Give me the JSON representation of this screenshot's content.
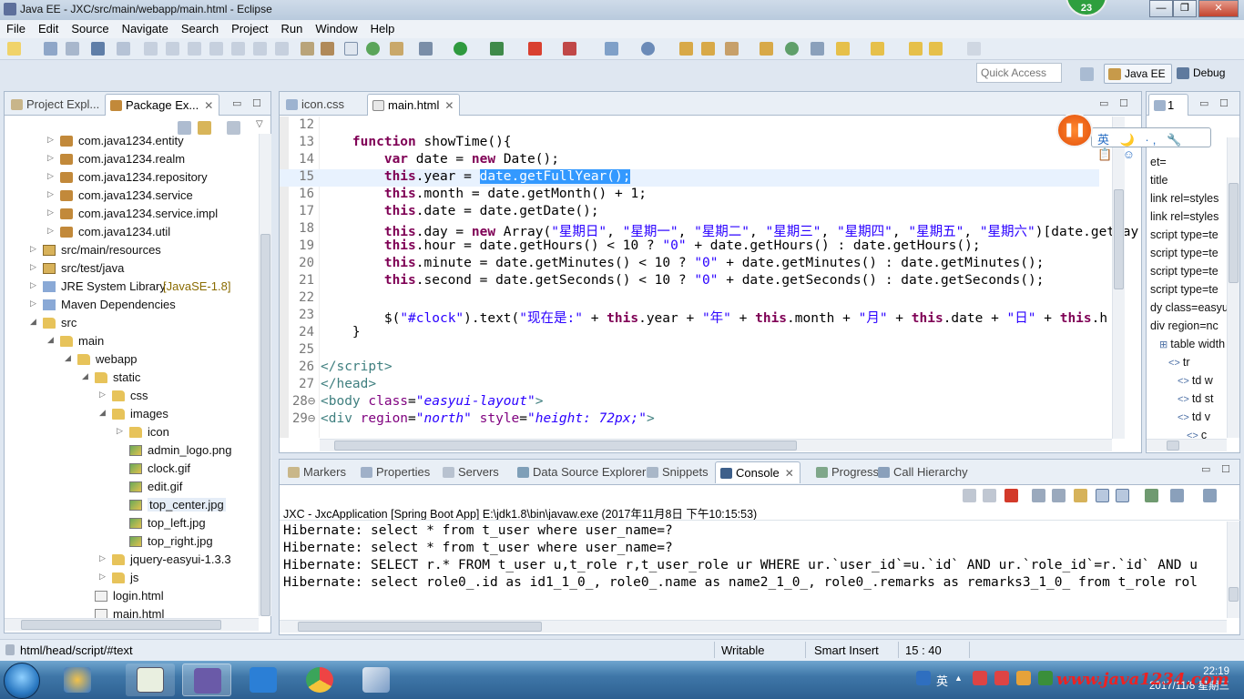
{
  "window": {
    "title": "Java EE - JXC/src/main/webapp/main.html - Eclipse",
    "badge": "23"
  },
  "menu": [
    "File",
    "Edit",
    "Source",
    "Navigate",
    "Search",
    "Project",
    "Run",
    "Window",
    "Help"
  ],
  "perspectives": {
    "quick_access_placeholder": "Quick Access",
    "items": [
      "Java EE",
      "Debug"
    ]
  },
  "explorer": {
    "tabs": [
      "Project Expl...",
      "Package Ex..."
    ],
    "items": [
      {
        "label": "com.java1234.entity",
        "icon": "pkg",
        "indent": 3,
        "twisty": "▷"
      },
      {
        "label": "com.java1234.realm",
        "icon": "pkg",
        "indent": 3,
        "twisty": "▷"
      },
      {
        "label": "com.java1234.repository",
        "icon": "pkg",
        "indent": 3,
        "twisty": "▷"
      },
      {
        "label": "com.java1234.service",
        "icon": "pkg",
        "indent": 3,
        "twisty": "▷"
      },
      {
        "label": "com.java1234.service.impl",
        "icon": "pkg",
        "indent": 3,
        "twisty": "▷"
      },
      {
        "label": "com.java1234.util",
        "icon": "pkg",
        "indent": 3,
        "twisty": "▷"
      },
      {
        "label": "src/main/resources",
        "icon": "srcf",
        "indent": 2,
        "twisty": "▷"
      },
      {
        "label": "src/test/java",
        "icon": "srcf",
        "indent": 2,
        "twisty": "▷"
      },
      {
        "label": "JRE System Library",
        "suffix": "[JavaSE-1.8]",
        "icon": "lib",
        "indent": 2,
        "twisty": "▷"
      },
      {
        "label": "Maven Dependencies",
        "icon": "lib",
        "indent": 2,
        "twisty": "▷"
      },
      {
        "label": "src",
        "icon": "folder",
        "indent": 2,
        "twisty": "◢"
      },
      {
        "label": "main",
        "icon": "folder",
        "indent": 3,
        "twisty": "◢"
      },
      {
        "label": "webapp",
        "icon": "folder",
        "indent": 4,
        "twisty": "◢"
      },
      {
        "label": "static",
        "icon": "folder",
        "indent": 5,
        "twisty": "◢"
      },
      {
        "label": "css",
        "icon": "folder",
        "indent": 6,
        "twisty": "▷"
      },
      {
        "label": "images",
        "icon": "folder",
        "indent": 6,
        "twisty": "◢"
      },
      {
        "label": "icon",
        "icon": "folder",
        "indent": 7,
        "twisty": "▷"
      },
      {
        "label": "admin_logo.png",
        "icon": "img",
        "indent": 7,
        "twisty": ""
      },
      {
        "label": "clock.gif",
        "icon": "img",
        "indent": 7,
        "twisty": ""
      },
      {
        "label": "edit.gif",
        "icon": "img",
        "indent": 7,
        "twisty": ""
      },
      {
        "label": "top_center.jpg",
        "icon": "img",
        "indent": 7,
        "twisty": "",
        "selected": true
      },
      {
        "label": "top_left.jpg",
        "icon": "img",
        "indent": 7,
        "twisty": ""
      },
      {
        "label": "top_right.jpg",
        "icon": "img",
        "indent": 7,
        "twisty": ""
      },
      {
        "label": "jquery-easyui-1.3.3",
        "icon": "folder",
        "indent": 6,
        "twisty": "▷"
      },
      {
        "label": "js",
        "icon": "folder",
        "indent": 6,
        "twisty": "▷"
      },
      {
        "label": "login.html",
        "icon": "html",
        "indent": 5,
        "twisty": ""
      },
      {
        "label": "main.html",
        "icon": "html",
        "indent": 5,
        "twisty": ""
      }
    ]
  },
  "editor": {
    "tabs": [
      "icon.css",
      "main.html"
    ],
    "lines": [
      {
        "n": "12",
        "html": ""
      },
      {
        "n": "13",
        "html": "    <span class='kw'>function</span> showTime(){"
      },
      {
        "n": "14",
        "html": "        <span class='kw'>var</span> date = <span class='kw'>new</span> Date();"
      },
      {
        "n": "15",
        "html": "        <span class='kw'>this</span>.year = <span class='sel-hl'>date.getFullYear();</span>",
        "current": true
      },
      {
        "n": "16",
        "html": "        <span class='kw'>this</span>.month = date.getMonth() + 1;"
      },
      {
        "n": "17",
        "html": "        <span class='kw'>this</span>.date = date.getDate();"
      },
      {
        "n": "18",
        "html": "        <span class='kw'>this</span>.day = <span class='kw'>new</span> Array(<span class='str'>\"星期日\"</span>, <span class='str'>\"星期一\"</span>, <span class='str'>\"星期二\"</span>, <span class='str'>\"星期三\"</span>, <span class='str'>\"星期四\"</span>, <span class='str'>\"星期五\"</span>, <span class='str'>\"星期六\"</span>)[date.getDay("
      },
      {
        "n": "19",
        "html": "        <span class='kw'>this</span>.hour = date.getHours() &lt; 10 ? <span class='str'>\"0\"</span> + date.getHours() : date.getHours();"
      },
      {
        "n": "20",
        "html": "        <span class='kw'>this</span>.minute = date.getMinutes() &lt; 10 ? <span class='str'>\"0\"</span> + date.getMinutes() : date.getMinutes();"
      },
      {
        "n": "21",
        "html": "        <span class='kw'>this</span>.second = date.getSeconds() &lt; 10 ? <span class='str'>\"0\"</span> + date.getSeconds() : date.getSeconds();"
      },
      {
        "n": "22",
        "html": ""
      },
      {
        "n": "23",
        "html": "        $(<span class='str'>\"#clock\"</span>).text(<span class='str'>\"现在是:\"</span> + <span class='kw'>this</span>.year + <span class='str'>\"年\"</span> + <span class='kw'>this</span>.month + <span class='str'>\"月\"</span> + <span class='kw'>this</span>.date + <span class='str'>\"日\"</span> + <span class='kw'>this</span>.h"
      },
      {
        "n": "24",
        "html": "    }"
      },
      {
        "n": "25",
        "html": ""
      },
      {
        "n": "26",
        "html": "<span class='tag'>&lt;/script&gt;</span>"
      },
      {
        "n": "27",
        "html": "<span class='tag'>&lt;/head&gt;</span>"
      },
      {
        "n": "28⊖",
        "html": "<span class='tag'>&lt;body</span> <span class='attr'>class</span>=<span class='attrv'>\"easyui-layout\"</span><span class='tag'>&gt;</span>"
      },
      {
        "n": "29⊖",
        "html": "<span class='tag'>&lt;div</span> <span class='attr'>region</span>=<span class='attrv'>\"north\"</span> <span class='attr'>style</span>=<span class='attrv'>\"height: 72px;\"</span><span class='tag'>&gt;</span>"
      }
    ]
  },
  "outline": {
    "tab_label": "1",
    "items": [
      {
        "label": "et=",
        "indent": 0
      },
      {
        "label": "title",
        "indent": 0
      },
      {
        "label": "link rel=styles",
        "indent": 0
      },
      {
        "label": "link rel=styles",
        "indent": 0
      },
      {
        "label": "script type=te",
        "indent": 0
      },
      {
        "label": "script type=te",
        "indent": 0
      },
      {
        "label": "script type=te",
        "indent": 0
      },
      {
        "label": "script type=te",
        "indent": 0
      },
      {
        "label": "dy class=easyu",
        "indent": 0
      },
      {
        "label": "div region=nc",
        "indent": 0
      },
      {
        "label": "table width",
        "indent": 1
      },
      {
        "label": "tr",
        "indent": 2
      },
      {
        "label": "td w",
        "indent": 3
      },
      {
        "label": "td st",
        "indent": 3
      },
      {
        "label": "td v",
        "indent": 3
      },
      {
        "label": "c",
        "indent": 4
      }
    ]
  },
  "console": {
    "tabs": [
      "Markers",
      "Properties",
      "Servers",
      "Data Source Explorer",
      "Snippets",
      "Console",
      "Progress",
      "Call Hierarchy"
    ],
    "header": "JXC - JxcApplication [Spring Boot App] E:\\jdk1.8\\bin\\javaw.exe (2017年11月8日 下午10:15:53)",
    "lines": [
      "Hibernate: select * from t_user where user_name=?",
      "Hibernate: select * from t_user where user_name=?",
      "Hibernate: SELECT r.* FROM t_user u,t_role r,t_user_role ur WHERE ur.`user_id`=u.`id` AND ur.`role_id`=r.`id` AND u",
      "Hibernate: select role0_.id as id1_1_0_, role0_.name as name2_1_0_, role0_.remarks as remarks3_1_0_ from t_role rol"
    ]
  },
  "status": {
    "path": "html/head/script/#text",
    "mode": "Writable",
    "insert": "Smart Insert",
    "position": "15 : 40"
  },
  "ime": {
    "label": "英 🌙 ·, 🔧 📋 ☺"
  },
  "taskbar": {
    "time": "22:19",
    "date": "2017/11/8 星期三",
    "watermark": "www.java1234.com",
    "ime_tray": "英"
  }
}
